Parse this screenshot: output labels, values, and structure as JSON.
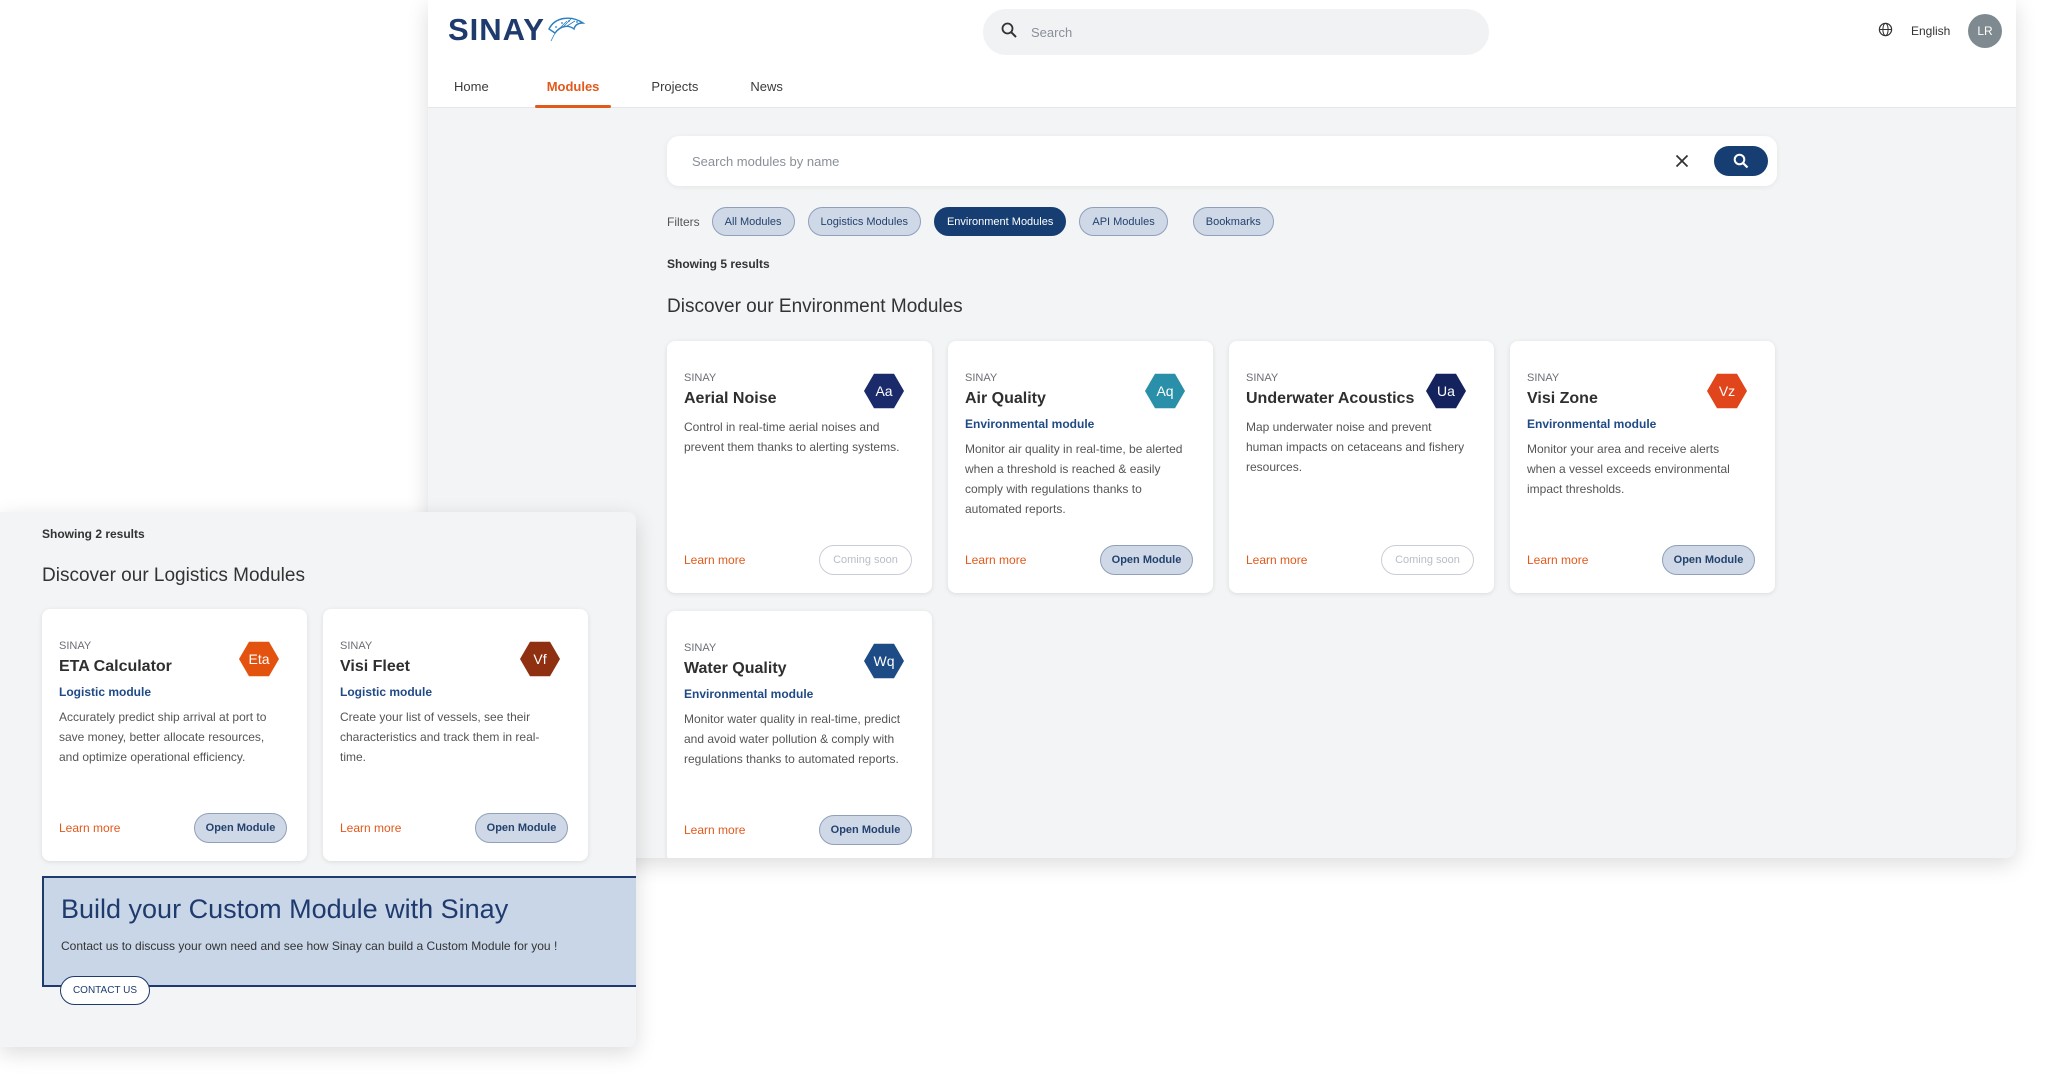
{
  "header": {
    "logo_text": "SINAY",
    "search_placeholder": "Search",
    "language": "English",
    "avatar_initials": "LR",
    "nav": [
      {
        "label": "Home",
        "active": false
      },
      {
        "label": "Modules",
        "active": true
      },
      {
        "label": "Projects",
        "active": false
      },
      {
        "label": "News",
        "active": false
      }
    ]
  },
  "module_search": {
    "placeholder": "Search modules by name"
  },
  "filters": {
    "label": "Filters",
    "chips": [
      {
        "label": "All Modules",
        "active": false
      },
      {
        "label": "Logistics Modules",
        "active": false
      },
      {
        "label": "Environment Modules",
        "active": true
      },
      {
        "label": "API Modules",
        "active": false
      },
      {
        "label": "Bookmarks",
        "active": false
      }
    ]
  },
  "environment": {
    "showing": "Showing 5 results",
    "title": "Discover our Environment Modules",
    "cards": [
      {
        "brand": "SINAY",
        "title": "Aerial Noise",
        "type": "",
        "code": "Aa",
        "color": "#1a2a6b",
        "desc_lines": [
          "Control in real-time aerial noises and",
          "prevent them thanks to alerting systems."
        ],
        "learn_more": "Learn more",
        "button": "Coming soon",
        "button_state": "disabled"
      },
      {
        "brand": "SINAY",
        "title": "Air Quality",
        "type": "Environmental module",
        "code": "Aq",
        "color": "#2a8fa8",
        "desc_lines": [
          "Monitor air quality in real-time, be alerted",
          "when a threshold is reached & easily",
          "comply with regulations thanks to",
          "automated reports."
        ],
        "learn_more": "Learn more",
        "button": "Open Module",
        "button_state": "enabled"
      },
      {
        "brand": "SINAY",
        "title": "Underwater Acoustics",
        "type": "",
        "code": "Ua",
        "color": "#14235e",
        "desc_lines": [
          "Map underwater noise and prevent",
          "human impacts on cetaceans and fishery",
          "resources."
        ],
        "learn_more": "Learn more",
        "button": "Coming soon",
        "button_state": "disabled"
      },
      {
        "brand": "SINAY",
        "title": "Visi Zone",
        "type": "Environmental module",
        "code": "Vz",
        "color": "#e0451c",
        "desc_lines": [
          "Monitor your area and receive alerts",
          "when a vessel exceeds environmental",
          "impact thresholds."
        ],
        "learn_more": "Learn more",
        "button": "Open Module",
        "button_state": "enabled"
      },
      {
        "brand": "SINAY",
        "title": "Water Quality",
        "type": "Environmental module",
        "code": "Wq",
        "color": "#1c4b86",
        "desc_lines": [
          "Monitor water quality in real-time, predict",
          "and avoid water pollution & comply with",
          "regulations thanks to automated reports."
        ],
        "learn_more": "Learn more",
        "button": "Open Module",
        "button_state": "enabled"
      }
    ]
  },
  "logistics": {
    "showing": "Showing 2 results",
    "title": "Discover our Logistics Modules",
    "cards": [
      {
        "brand": "SINAY",
        "title": "ETA Calculator",
        "type": "Logistic module",
        "code": "Eta",
        "color": "#e3520e",
        "desc_lines": [
          "Accurately predict ship arrival at port to",
          "save money, better allocate resources,",
          "and optimize operational efficiency."
        ],
        "learn_more": "Learn more",
        "button": "Open Module",
        "button_state": "enabled"
      },
      {
        "brand": "SINAY",
        "title": "Visi Fleet",
        "type": "Logistic module",
        "code": "Vf",
        "color": "#8f3010",
        "desc_lines": [
          "Create your list of vessels, see their",
          "characteristics and track them in real-",
          "time."
        ],
        "learn_more": "Learn more",
        "button": "Open Module",
        "button_state": "enabled"
      }
    ]
  },
  "custom_module": {
    "title": "Build your Custom Module with Sinay",
    "desc": "Contact us to discuss your own need and see how Sinay can build a Custom Module for you !",
    "button": "CONTACT US"
  },
  "colors": {
    "accent": "#e2591c",
    "primary": "#173e73",
    "chip_bg": "#cfd8e6",
    "page_bg": "#f2f4f5"
  },
  "icons": [
    "search-icon",
    "globe-icon",
    "close-icon",
    "dolphin-logo-icon"
  ]
}
